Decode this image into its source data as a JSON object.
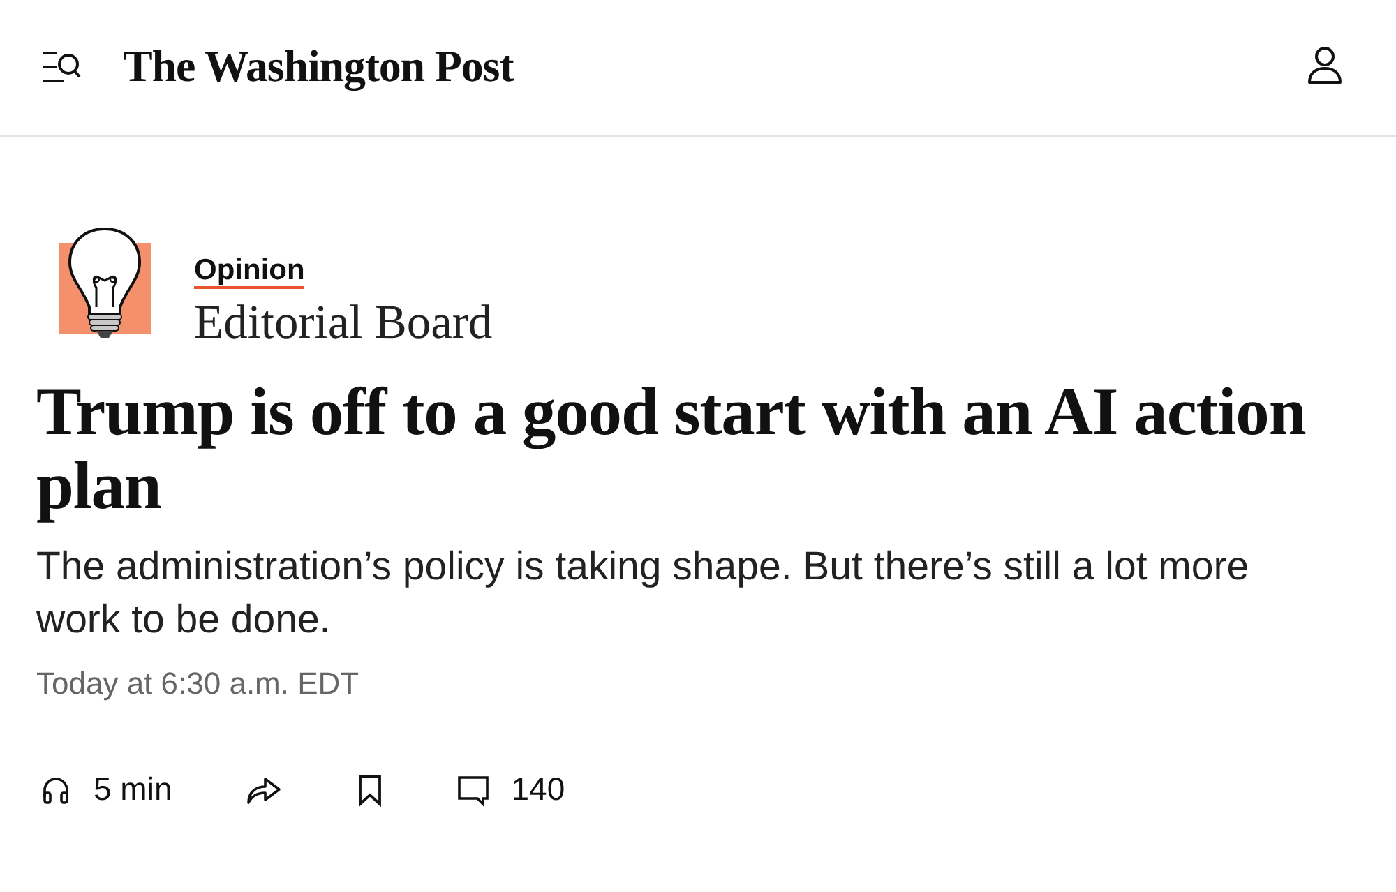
{
  "header": {
    "logo": "The Washington Post"
  },
  "byline": {
    "section": "Opinion",
    "author": "Editorial Board"
  },
  "headline": "Trump is off to a good start with an AI action plan",
  "dek": "The administration’s policy is taking shape. But there’s still a lot more work to be done.",
  "timestamp": "Today at 6:30 a.m. EDT",
  "actions": [
    {
      "kind": "listen",
      "label": "5 min"
    },
    {
      "kind": "share"
    },
    {
      "kind": "save"
    },
    {
      "kind": "comments",
      "label": "140"
    }
  ]
}
